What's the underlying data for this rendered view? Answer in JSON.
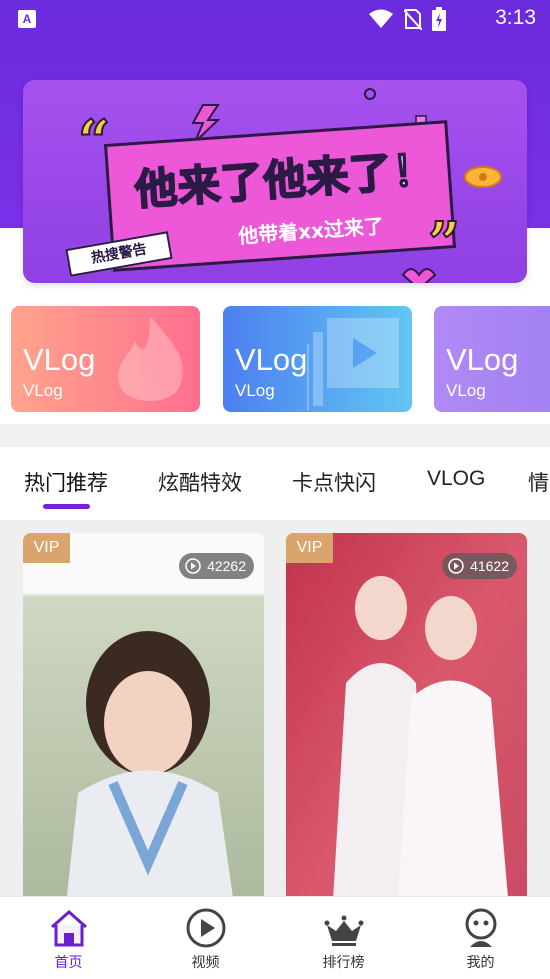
{
  "status_bar": {
    "time": "3:13",
    "app_icon_letter": "A"
  },
  "banner": {
    "title": "他来了他来了！",
    "subtitle": "他带着xx过来了",
    "tag": "热搜警告",
    "open_quote": "“",
    "close_quote": "”"
  },
  "categories": [
    {
      "title": "VLog",
      "subtitle": "VLog",
      "color_from": "#ffa48c",
      "color_to": "#ff6f8e"
    },
    {
      "title": "VLog",
      "subtitle": "VLog",
      "color_from": "#4c7ff0",
      "color_to": "#62c6f2"
    },
    {
      "title": "VLog",
      "subtitle": "VLog",
      "color_from": "#b08af5",
      "color_to": "#9b7cf0"
    }
  ],
  "tabs": [
    {
      "label": "热门推荐"
    },
    {
      "label": "炫酷特效"
    },
    {
      "label": "卡点快闪"
    },
    {
      "label": "VLOG"
    },
    {
      "label": "情"
    }
  ],
  "videos": [
    {
      "badge": "VIP",
      "plays": "42262"
    },
    {
      "badge": "VIP",
      "plays": "41622"
    }
  ],
  "nav": [
    {
      "label": "首页",
      "icon": "home-icon",
      "active": true
    },
    {
      "label": "视频",
      "icon": "play-icon",
      "active": false
    },
    {
      "label": "排行榜",
      "icon": "crown-icon",
      "active": false
    },
    {
      "label": "我的",
      "icon": "profile-icon",
      "active": false
    }
  ],
  "colors": {
    "accent": "#7a21d8",
    "header": "#6a2bdc",
    "vip": "#d9a56c"
  }
}
